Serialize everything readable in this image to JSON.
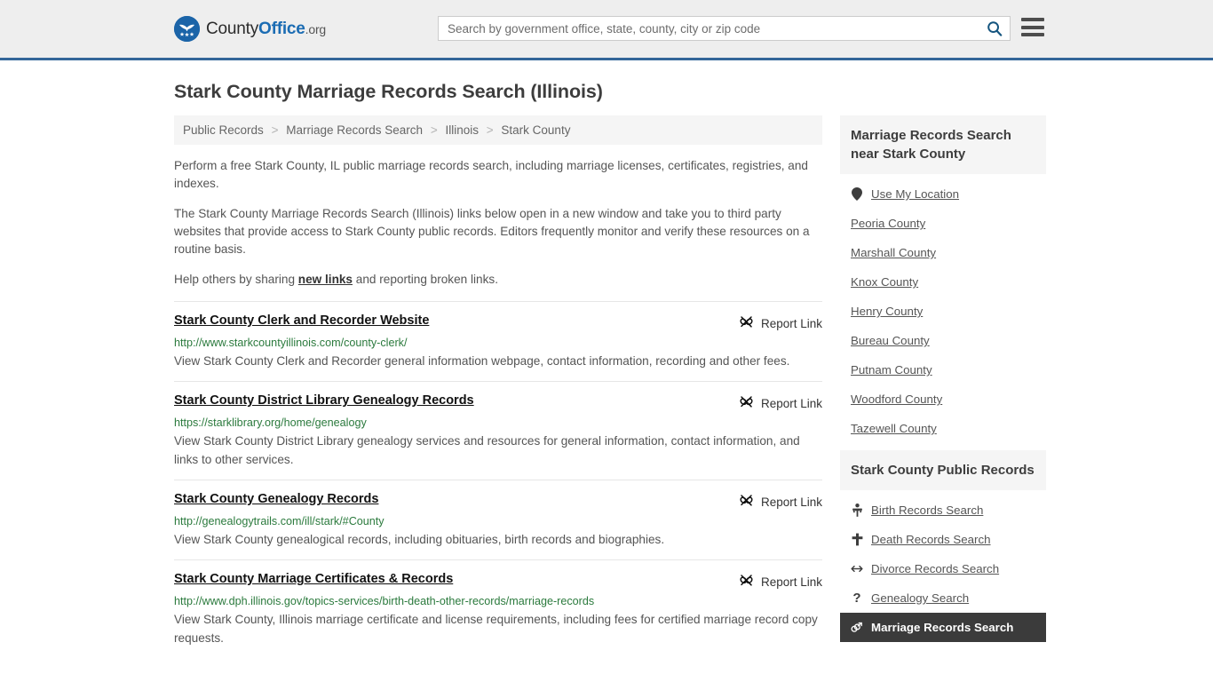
{
  "header": {
    "logo": {
      "part1": "County",
      "part2": "Office",
      "part3": ".org",
      "icon": "eagle-stars-seal-icon"
    },
    "search": {
      "placeholder": "Search by government office, state, county, city or zip code",
      "value": "",
      "icon": "search-icon"
    },
    "menu_icon": "hamburger-menu-icon"
  },
  "page": {
    "title": "Stark County Marriage Records Search (Illinois)"
  },
  "breadcrumb": {
    "separator": ">",
    "items": [
      {
        "label": "Public Records"
      },
      {
        "label": "Marriage Records Search"
      },
      {
        "label": "Illinois"
      },
      {
        "label": "Stark County"
      }
    ]
  },
  "intro": {
    "p1": "Perform a free Stark County, IL public marriage records search, including marriage licenses, certificates, registries, and indexes.",
    "p2": "The Stark County Marriage Records Search (Illinois) links below open in a new window and take you to third party websites that provide access to Stark County public records. Editors frequently monitor and verify these resources on a routine basis.",
    "p3_before": "Help others by sharing ",
    "p3_link": "new links",
    "p3_after": " and reporting broken links."
  },
  "report_link_label": "Report Link",
  "report_link_icon": "broken-link-icon",
  "results": [
    {
      "title": "Stark County Clerk and Recorder Website",
      "url": "http://www.starkcountyillinois.com/county-clerk/",
      "description": "View Stark County Clerk and Recorder general information webpage, contact information, recording and other fees."
    },
    {
      "title": "Stark County District Library Genealogy Records",
      "url": "https://starklibrary.org/home/genealogy",
      "description": "View Stark County District Library genealogy services and resources for general information, contact information, and links to other services."
    },
    {
      "title": "Stark County Genealogy Records",
      "url": "http://genealogytrails.com/ill/stark/#County",
      "description": "View Stark County genealogical records, including obituaries, birth records and biographies."
    },
    {
      "title": "Stark County Marriage Certificates & Records",
      "url": "http://www.dph.illinois.gov/topics-services/birth-death-other-records/marriage-records",
      "description": "View Stark County, Illinois marriage certificate and license requirements, including fees for certified marriage record copy requests."
    }
  ],
  "sidebar": {
    "nearby": {
      "heading": "Marriage Records Search near Stark County",
      "items": [
        {
          "label": "Use My Location",
          "icon": "map-pin-icon"
        },
        {
          "label": "Peoria County",
          "icon": ""
        },
        {
          "label": "Marshall County",
          "icon": ""
        },
        {
          "label": "Knox County",
          "icon": ""
        },
        {
          "label": "Henry County",
          "icon": ""
        },
        {
          "label": "Bureau County",
          "icon": ""
        },
        {
          "label": "Putnam County",
          "icon": ""
        },
        {
          "label": "Woodford County",
          "icon": ""
        },
        {
          "label": "Tazewell County",
          "icon": ""
        }
      ]
    },
    "public_records": {
      "heading": "Stark County Public Records",
      "items": [
        {
          "label": "Birth Records Search",
          "icon": "baby-icon",
          "active": false
        },
        {
          "label": "Death Records Search",
          "icon": "cross-icon",
          "active": false
        },
        {
          "label": "Divorce Records Search",
          "icon": "arrows-left-right-icon",
          "active": false
        },
        {
          "label": "Genealogy Search",
          "icon": "question-mark-icon",
          "active": false
        },
        {
          "label": "Marriage Records Search",
          "icon": "venus-mars-icon",
          "active": true
        }
      ]
    }
  },
  "colors": {
    "header_bg": "#eeeeee",
    "header_border": "#336699",
    "brand_blue": "#1b6cb3",
    "url_green": "#2b7a3d",
    "active_bg": "#3b3b3b",
    "panel_bg": "#f5f5f5"
  }
}
